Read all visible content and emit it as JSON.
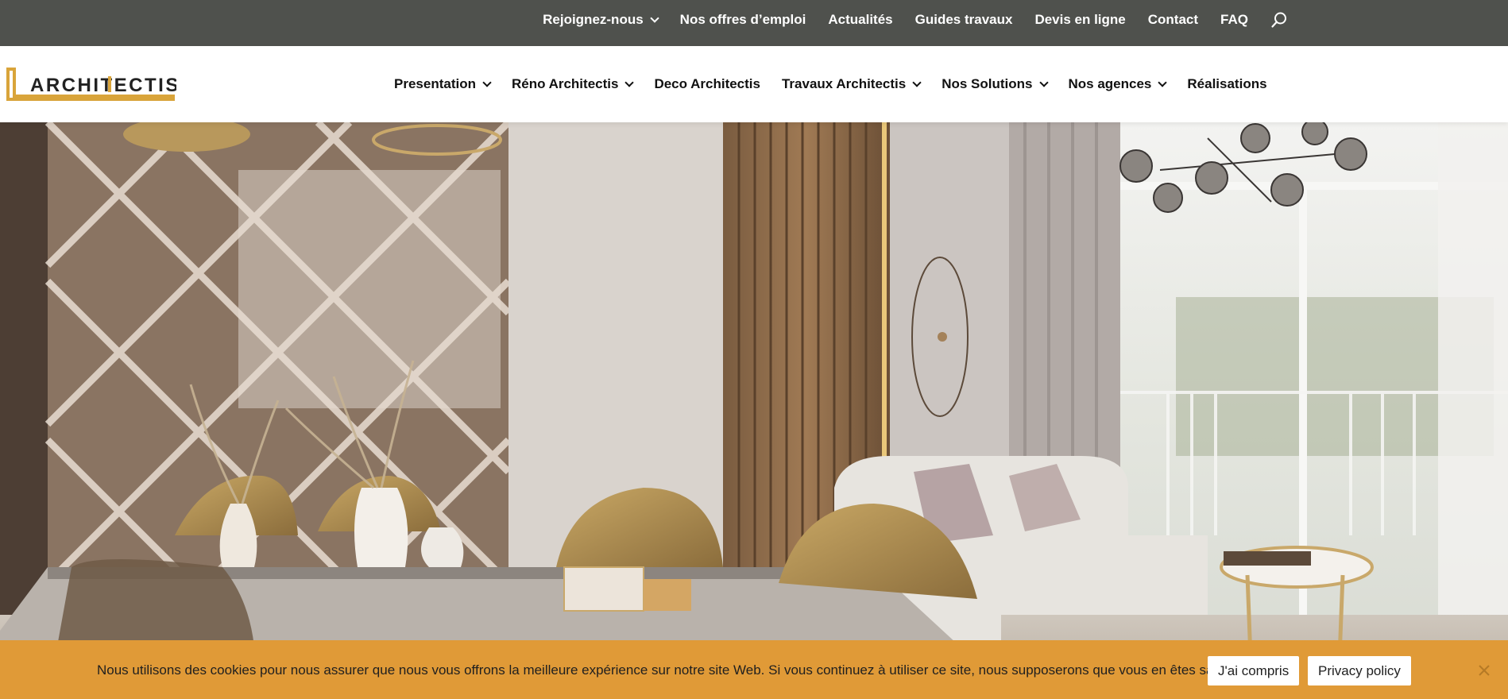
{
  "topbar": {
    "items": [
      {
        "label": "Rejoignez-nous",
        "dropdown": true
      },
      {
        "label": "Nos offres d’emploi",
        "dropdown": false
      },
      {
        "label": "Actualités",
        "dropdown": false
      },
      {
        "label": "Guides travaux",
        "dropdown": false
      },
      {
        "label": "Devis en ligne",
        "dropdown": false
      },
      {
        "label": "Contact",
        "dropdown": false
      },
      {
        "label": "FAQ",
        "dropdown": false
      }
    ],
    "search_icon": "search-icon"
  },
  "header": {
    "logo_text": "ARCHITECTIS",
    "nav": [
      {
        "label": "Presentation",
        "dropdown": true
      },
      {
        "label": "Réno Architectis",
        "dropdown": true
      },
      {
        "label": "Deco Architectis",
        "dropdown": false
      },
      {
        "label": "Travaux Architectis",
        "dropdown": true
      },
      {
        "label": "Nos Solutions",
        "dropdown": true
      },
      {
        "label": "Nos agences",
        "dropdown": true
      },
      {
        "label": "Réalisations",
        "dropdown": false
      }
    ]
  },
  "cookie_banner": {
    "message": "Nous utilisons des cookies pour nous assurer que nous vous offrons la meilleure expérience sur notre site Web. Si vous continuez à utiliser ce site, nous supposerons que vous en êtes satisfait.",
    "accept_label": "J'ai compris",
    "privacy_label": "Privacy policy",
    "close_icon": "close-icon"
  },
  "colors": {
    "topbar_bg": "#4f514d",
    "accent_gold": "#d9a43a",
    "cookie_bg": "#e09a37"
  }
}
